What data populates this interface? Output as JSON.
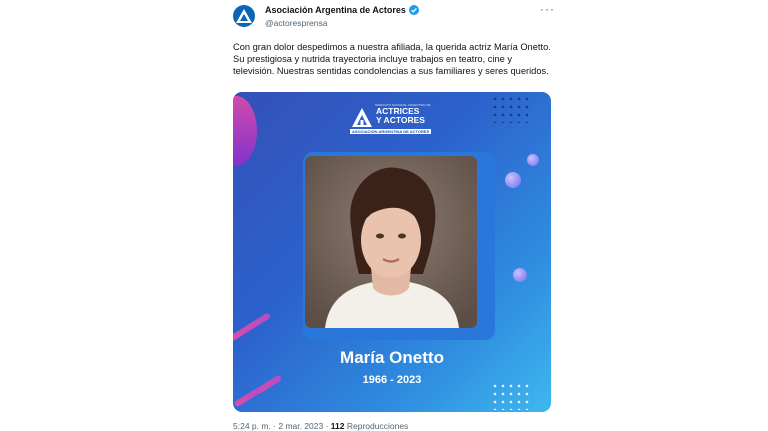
{
  "account": {
    "display_name": "Asociación Argentina de Actores",
    "handle": "@actoresprensa",
    "verified": true,
    "avatar_icon": "aaa-logo-icon"
  },
  "tweet": {
    "text": "Con gran dolor despedimos a nuestra afiliada, la querida actriz María Onetto. Su prestigiosa y nutrida trayectoria incluye trabajos en teatro, cine y televisión. Nuestras sentidas condolencias a sus familiares y seres queridos."
  },
  "card": {
    "logo_line_top": "SINDICATO NACIONAL ARGENTINO DE",
    "logo_title_1": "ACTRICES",
    "logo_title_2": "Y ACTORES",
    "logo_subtitle": "ASOCIACIÓN ARGENTINA DE ACTORES",
    "person_name": "María Onetto",
    "years": "1966 - 2023"
  },
  "meta": {
    "time": "5:24 p. m. · 2 mar. 2023 · ",
    "views_count": "112",
    "views_label": " Reproducciones"
  },
  "colors": {
    "card_gradient_start": "#3450b8",
    "card_gradient_end": "#3fb7ee",
    "accent_pink": "#e04aa5",
    "verified_blue": "#1d9bf0"
  }
}
